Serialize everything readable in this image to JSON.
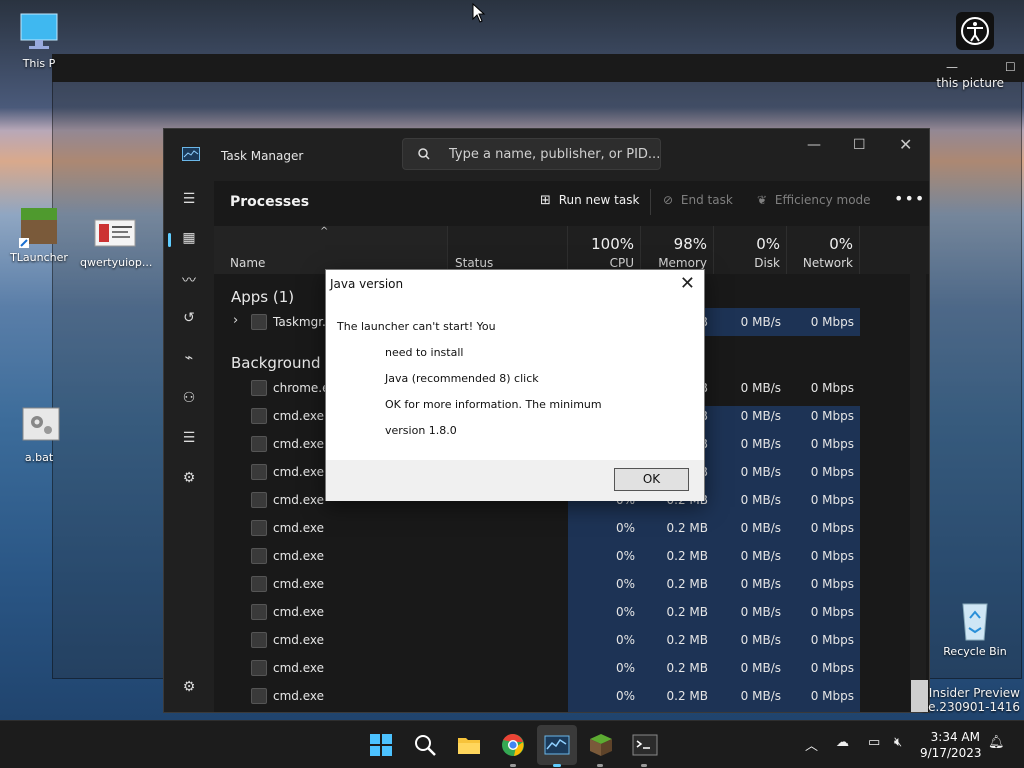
{
  "desktop": {
    "icons": [
      {
        "label": "This P"
      },
      {
        "label": "TLauncher"
      },
      {
        "label": "qwertyuiop..."
      },
      {
        "label": "a.bat"
      },
      {
        "label": "Recycle Bin"
      }
    ],
    "partial_label_right": "this picture"
  },
  "task_manager": {
    "title": "Task Manager",
    "search_placeholder": "Type a name, publisher, or PID...",
    "page_title": "Processes",
    "toolbar": {
      "run_new_task": "Run new task",
      "end_task": "End task",
      "efficiency_mode": "Efficiency mode"
    },
    "columns": {
      "name": "Name",
      "status": "Status",
      "cpu_pct": "100%",
      "cpu": "CPU",
      "memory_pct": "98%",
      "memory": "Memory",
      "disk_pct": "0%",
      "disk": "Disk",
      "network_pct": "0%",
      "network": "Network"
    },
    "groups": {
      "apps": "Apps (1)",
      "background": "Background p"
    },
    "app_row": {
      "name": "Taskmgr.e",
      "memory": "B",
      "disk": "0 MB/s",
      "network": "0 Mbps"
    },
    "background_rows": [
      {
        "name": "chrome.ex",
        "cpu": "",
        "memory": "B",
        "disk": "0 MB/s",
        "network": "0 Mbps"
      },
      {
        "name": "cmd.exe",
        "cpu": "",
        "memory": "B",
        "disk": "0 MB/s",
        "network": "0 Mbps"
      },
      {
        "name": "cmd.exe",
        "cpu": "",
        "memory": "B",
        "disk": "0 MB/s",
        "network": "0 Mbps"
      },
      {
        "name": "cmd.exe",
        "cpu": "",
        "memory": "B",
        "disk": "0 MB/s",
        "network": "0 Mbps"
      },
      {
        "name": "cmd.exe",
        "cpu": "0%",
        "memory": "0.2 MB",
        "disk": "0 MB/s",
        "network": "0 Mbps"
      },
      {
        "name": "cmd.exe",
        "cpu": "0%",
        "memory": "0.2 MB",
        "disk": "0 MB/s",
        "network": "0 Mbps"
      },
      {
        "name": "cmd.exe",
        "cpu": "0%",
        "memory": "0.2 MB",
        "disk": "0 MB/s",
        "network": "0 Mbps"
      },
      {
        "name": "cmd.exe",
        "cpu": "0%",
        "memory": "0.2 MB",
        "disk": "0 MB/s",
        "network": "0 Mbps"
      },
      {
        "name": "cmd.exe",
        "cpu": "0%",
        "memory": "0.2 MB",
        "disk": "0 MB/s",
        "network": "0 Mbps"
      },
      {
        "name": "cmd.exe",
        "cpu": "0%",
        "memory": "0.2 MB",
        "disk": "0 MB/s",
        "network": "0 Mbps"
      },
      {
        "name": "cmd.exe",
        "cpu": "0%",
        "memory": "0.2 MB",
        "disk": "0 MB/s",
        "network": "0 Mbps"
      },
      {
        "name": "cmd.exe",
        "cpu": "0%",
        "memory": "0.2 MB",
        "disk": "0 MB/s",
        "network": "0 Mbps"
      }
    ]
  },
  "dialog": {
    "title": "Java version",
    "lines": [
      "The launcher can't start! You",
      "need to install",
      "Java (recommended 8) click",
      "OK for more information. The minimum",
      "version 1.8.0"
    ],
    "ok": "OK"
  },
  "taskbar": {
    "time": "3:34 AM",
    "date": "9/17/2023"
  },
  "watermark": {
    "line1": "Insider Preview",
    "line2": "se.230901-1416"
  },
  "colors": {
    "accent": "#60cdff",
    "heat": "#1d3355"
  }
}
